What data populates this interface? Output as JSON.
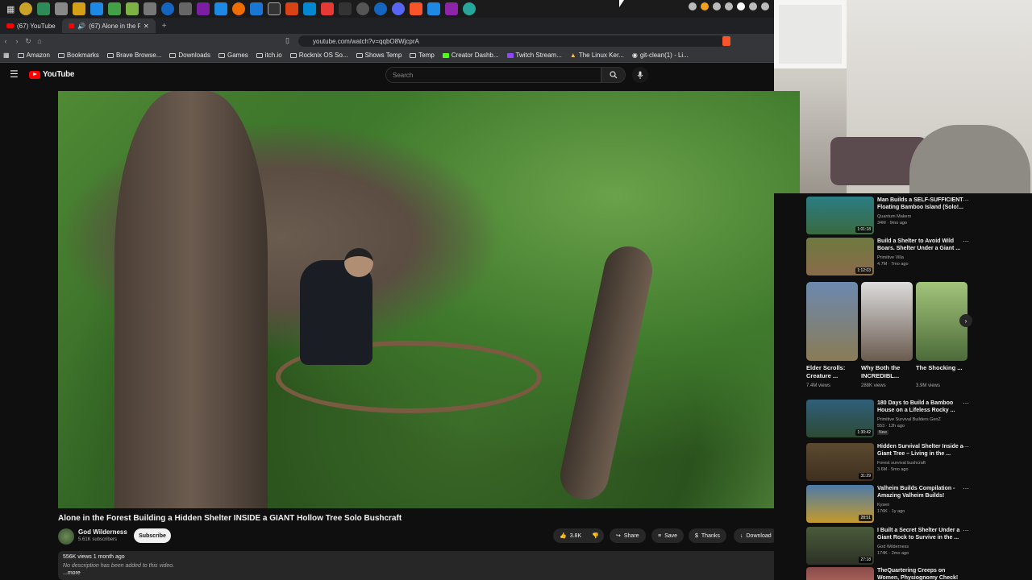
{
  "browser": {
    "tabs": [
      {
        "label": "(67) YouTube",
        "active": false
      },
      {
        "label": "(67) Alone in the Fore",
        "active": true
      }
    ],
    "new_tab_label": "+",
    "url": "youtube.com/watch?v=qqbO8WjcprA",
    "bookmarks": [
      "Amazon",
      "Bookmarks",
      "Brave Browse...",
      "Downloads",
      "Games",
      "itch.io",
      "Rocknix OS So...",
      "Shows Temp",
      "Temp",
      "Creator Dashb...",
      "Twitch Stream...",
      "The Linux Ker...",
      "git-clean(1) - Li..."
    ]
  },
  "youtube": {
    "logo_text": "YouTube",
    "search_placeholder": "Search",
    "video": {
      "title": "Alone in the Forest Building a Hidden Shelter INSIDE a GIANT Hollow Tree Solo Bushcraft",
      "channel": "God Wilderness",
      "subscribers": "5.61K subscribers",
      "subscribe_label": "Subscribe",
      "likes": "3.8K",
      "share_label": "Share",
      "save_label": "Save",
      "thanks_label": "Thanks",
      "download_label": "Download",
      "views_date": "556K views  1 month ago",
      "description": "No description has been added to this video.",
      "more_label": "...more"
    },
    "recommendations": [
      {
        "title": "Man Builds a SELF-SUFFICIENT Floating Bamboo Island (Solo!...",
        "channel": "Quantum Makers",
        "meta": "34M · 9mo ago",
        "duration": "1:01:18"
      },
      {
        "title": "Build a Shelter to Avoid Wild Boars. Shelter Under a Giant ...",
        "channel": "Primitive Villa",
        "meta": "4.7M · 7mo ago",
        "duration": "1:12:03"
      },
      {
        "title": "180 Days to Build a Bamboo House on a Lifeless Rocky ...",
        "channel": "Primitive Survival Builders GenZ",
        "meta": "553 · 12h ago",
        "duration": "1:30:42",
        "badge": "New"
      },
      {
        "title": "Hidden Survival Shelter Inside a Giant Tree – Living in the ...",
        "channel": "Forest survival bushcraft",
        "meta": "3.6M · 5mo ago",
        "duration": "31:29"
      },
      {
        "title": "Valheim Builds Compilation - Amazing Valheim Builds!",
        "channel": "Kysen",
        "meta": "176K · 1y ago",
        "duration": "28:51"
      },
      {
        "title": "I Built a Secret Shelter Under a Giant Rock to Survive in the ...",
        "channel": "God Wilderness",
        "meta": "174K · 2mo ago",
        "duration": "27:18"
      },
      {
        "title": "TheQuartering Creeps on Women, Physiognomy Check!",
        "channel": "",
        "meta": "",
        "duration": ""
      }
    ],
    "shorts": [
      {
        "title": "Elder Scrolls: Creature ...",
        "views": "7.4M views"
      },
      {
        "title": "Why Both the INCREDIBL...",
        "views": "288K views"
      },
      {
        "title": "The Shocking ...",
        "views": "3.9M views"
      }
    ]
  }
}
